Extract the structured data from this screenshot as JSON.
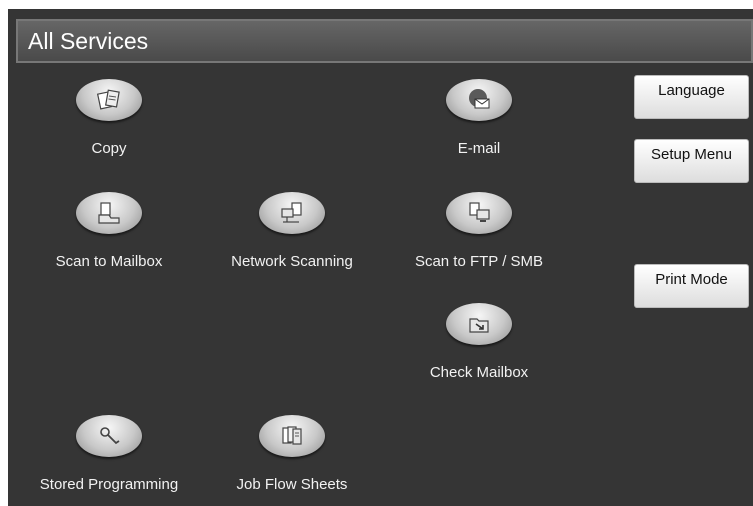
{
  "title": "All Services",
  "services": {
    "copy": {
      "label": "Copy",
      "icon": "copy-icon"
    },
    "email": {
      "label": "E-mail",
      "icon": "email-icon"
    },
    "scan_to_mailbox": {
      "label": "Scan to Mailbox",
      "icon": "scan-to-mailbox-icon"
    },
    "network_scanning": {
      "label": "Network Scanning",
      "icon": "network-scanning-icon"
    },
    "scan_to_ftp_smb": {
      "label": "Scan to FTP / SMB",
      "icon": "scan-to-ftp-smb-icon"
    },
    "check_mailbox": {
      "label": "Check Mailbox",
      "icon": "check-mailbox-icon"
    },
    "stored_programming": {
      "label": "Stored Programming",
      "icon": "stored-programming-icon"
    },
    "job_flow_sheets": {
      "label": "Job Flow Sheets",
      "icon": "job-flow-sheets-icon"
    }
  },
  "side_buttons": {
    "language": "Language",
    "setup_menu": "Setup Menu",
    "print_mode": "Print Mode"
  }
}
